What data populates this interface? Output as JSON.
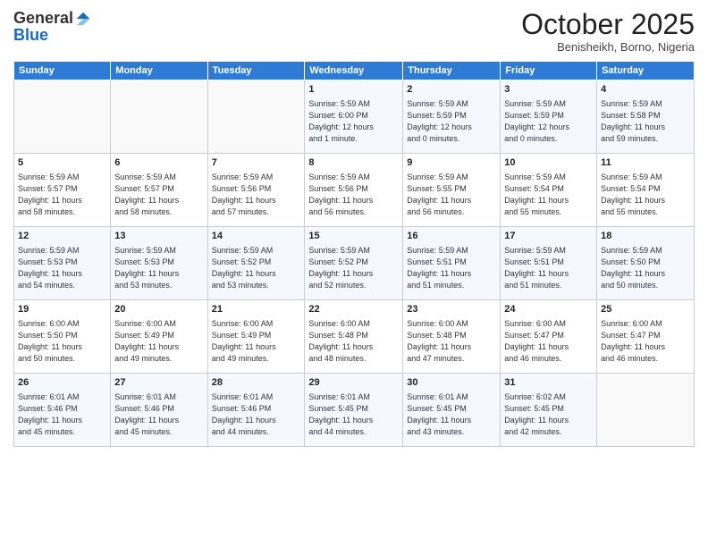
{
  "logo": {
    "general": "General",
    "blue": "Blue"
  },
  "header": {
    "month": "October 2025",
    "location": "Benisheikh, Borno, Nigeria"
  },
  "weekdays": [
    "Sunday",
    "Monday",
    "Tuesday",
    "Wednesday",
    "Thursday",
    "Friday",
    "Saturday"
  ],
  "weeks": [
    [
      {
        "day": "",
        "info": ""
      },
      {
        "day": "",
        "info": ""
      },
      {
        "day": "",
        "info": ""
      },
      {
        "day": "1",
        "info": "Sunrise: 5:59 AM\nSunset: 6:00 PM\nDaylight: 12 hours\nand 1 minute."
      },
      {
        "day": "2",
        "info": "Sunrise: 5:59 AM\nSunset: 5:59 PM\nDaylight: 12 hours\nand 0 minutes."
      },
      {
        "day": "3",
        "info": "Sunrise: 5:59 AM\nSunset: 5:59 PM\nDaylight: 12 hours\nand 0 minutes."
      },
      {
        "day": "4",
        "info": "Sunrise: 5:59 AM\nSunset: 5:58 PM\nDaylight: 11 hours\nand 59 minutes."
      }
    ],
    [
      {
        "day": "5",
        "info": "Sunrise: 5:59 AM\nSunset: 5:57 PM\nDaylight: 11 hours\nand 58 minutes."
      },
      {
        "day": "6",
        "info": "Sunrise: 5:59 AM\nSunset: 5:57 PM\nDaylight: 11 hours\nand 58 minutes."
      },
      {
        "day": "7",
        "info": "Sunrise: 5:59 AM\nSunset: 5:56 PM\nDaylight: 11 hours\nand 57 minutes."
      },
      {
        "day": "8",
        "info": "Sunrise: 5:59 AM\nSunset: 5:56 PM\nDaylight: 11 hours\nand 56 minutes."
      },
      {
        "day": "9",
        "info": "Sunrise: 5:59 AM\nSunset: 5:55 PM\nDaylight: 11 hours\nand 56 minutes."
      },
      {
        "day": "10",
        "info": "Sunrise: 5:59 AM\nSunset: 5:54 PM\nDaylight: 11 hours\nand 55 minutes."
      },
      {
        "day": "11",
        "info": "Sunrise: 5:59 AM\nSunset: 5:54 PM\nDaylight: 11 hours\nand 55 minutes."
      }
    ],
    [
      {
        "day": "12",
        "info": "Sunrise: 5:59 AM\nSunset: 5:53 PM\nDaylight: 11 hours\nand 54 minutes."
      },
      {
        "day": "13",
        "info": "Sunrise: 5:59 AM\nSunset: 5:53 PM\nDaylight: 11 hours\nand 53 minutes."
      },
      {
        "day": "14",
        "info": "Sunrise: 5:59 AM\nSunset: 5:52 PM\nDaylight: 11 hours\nand 53 minutes."
      },
      {
        "day": "15",
        "info": "Sunrise: 5:59 AM\nSunset: 5:52 PM\nDaylight: 11 hours\nand 52 minutes."
      },
      {
        "day": "16",
        "info": "Sunrise: 5:59 AM\nSunset: 5:51 PM\nDaylight: 11 hours\nand 51 minutes."
      },
      {
        "day": "17",
        "info": "Sunrise: 5:59 AM\nSunset: 5:51 PM\nDaylight: 11 hours\nand 51 minutes."
      },
      {
        "day": "18",
        "info": "Sunrise: 5:59 AM\nSunset: 5:50 PM\nDaylight: 11 hours\nand 50 minutes."
      }
    ],
    [
      {
        "day": "19",
        "info": "Sunrise: 6:00 AM\nSunset: 5:50 PM\nDaylight: 11 hours\nand 50 minutes."
      },
      {
        "day": "20",
        "info": "Sunrise: 6:00 AM\nSunset: 5:49 PM\nDaylight: 11 hours\nand 49 minutes."
      },
      {
        "day": "21",
        "info": "Sunrise: 6:00 AM\nSunset: 5:49 PM\nDaylight: 11 hours\nand 49 minutes."
      },
      {
        "day": "22",
        "info": "Sunrise: 6:00 AM\nSunset: 5:48 PM\nDaylight: 11 hours\nand 48 minutes."
      },
      {
        "day": "23",
        "info": "Sunrise: 6:00 AM\nSunset: 5:48 PM\nDaylight: 11 hours\nand 47 minutes."
      },
      {
        "day": "24",
        "info": "Sunrise: 6:00 AM\nSunset: 5:47 PM\nDaylight: 11 hours\nand 46 minutes."
      },
      {
        "day": "25",
        "info": "Sunrise: 6:00 AM\nSunset: 5:47 PM\nDaylight: 11 hours\nand 46 minutes."
      }
    ],
    [
      {
        "day": "26",
        "info": "Sunrise: 6:01 AM\nSunset: 5:46 PM\nDaylight: 11 hours\nand 45 minutes."
      },
      {
        "day": "27",
        "info": "Sunrise: 6:01 AM\nSunset: 5:46 PM\nDaylight: 11 hours\nand 45 minutes."
      },
      {
        "day": "28",
        "info": "Sunrise: 6:01 AM\nSunset: 5:46 PM\nDaylight: 11 hours\nand 44 minutes."
      },
      {
        "day": "29",
        "info": "Sunrise: 6:01 AM\nSunset: 5:45 PM\nDaylight: 11 hours\nand 44 minutes."
      },
      {
        "day": "30",
        "info": "Sunrise: 6:01 AM\nSunset: 5:45 PM\nDaylight: 11 hours\nand 43 minutes."
      },
      {
        "day": "31",
        "info": "Sunrise: 6:02 AM\nSunset: 5:45 PM\nDaylight: 11 hours\nand 42 minutes."
      },
      {
        "day": "",
        "info": ""
      }
    ]
  ]
}
